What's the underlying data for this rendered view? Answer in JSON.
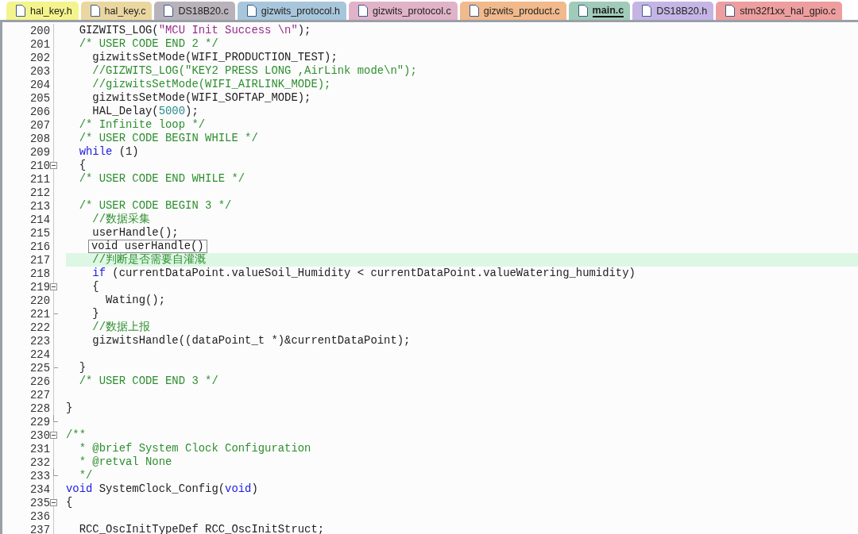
{
  "tabs": [
    {
      "label": "hal_key.h",
      "color": "#f4f48c",
      "selected": false
    },
    {
      "label": "hal_key.c",
      "color": "#ead7a0",
      "selected": false
    },
    {
      "label": "DS18B20.c",
      "color": "#b8b3ba",
      "selected": false
    },
    {
      "label": "gizwits_protocol.h",
      "color": "#a8c6db",
      "selected": false
    },
    {
      "label": "gizwits_protocol.c",
      "color": "#e0b3c8",
      "selected": false
    },
    {
      "label": "gizwits_product.c",
      "color": "#f1b98c",
      "selected": false
    },
    {
      "label": "main.c",
      "color": "#a0cbb8",
      "selected": true
    },
    {
      "label": "DS18B20.h",
      "color": "#c5b5e5",
      "selected": false
    },
    {
      "label": "stm32f1xx_hal_gpio.c",
      "color": "#ee9e9e",
      "selected": false
    }
  ],
  "lines": [
    {
      "number": "200",
      "tokens": [
        {
          "kind": "plain",
          "text": "  GIZWITS_LOG("
        },
        {
          "kind": "string",
          "text": "\"MCU Init Success \\n\""
        },
        {
          "kind": "plain",
          "text": ");"
        }
      ]
    },
    {
      "number": "201",
      "tokens": [
        {
          "kind": "comment",
          "text": "  /* USER CODE END 2 */"
        }
      ]
    },
    {
      "number": "202",
      "tokens": [
        {
          "kind": "plain",
          "text": "    gizwitsSetMode(WIFI_PRODUCTION_TEST);"
        }
      ]
    },
    {
      "number": "203",
      "tokens": [
        {
          "kind": "comment",
          "text": "    //GIZWITS_LOG(\"KEY2 PRESS LONG ,AirLink mode\\n\");"
        }
      ]
    },
    {
      "number": "204",
      "tokens": [
        {
          "kind": "comment",
          "text": "    //gizwitsSetMode(WIFI_AIRLINK_MODE);"
        }
      ]
    },
    {
      "number": "205",
      "tokens": [
        {
          "kind": "plain",
          "text": "    gizwitsSetMode(WIFI_SOFTAP_MODE);"
        }
      ]
    },
    {
      "number": "206",
      "tokens": [
        {
          "kind": "plain",
          "text": "    HAL_Delay("
        },
        {
          "kind": "number",
          "text": "5000"
        },
        {
          "kind": "plain",
          "text": ");"
        }
      ]
    },
    {
      "number": "207",
      "tokens": [
        {
          "kind": "comment",
          "text": "  /* Infinite loop */"
        }
      ]
    },
    {
      "number": "208",
      "tokens": [
        {
          "kind": "comment",
          "text": "  /* USER CODE BEGIN WHILE */"
        }
      ]
    },
    {
      "number": "209",
      "tokens": [
        {
          "kind": "keyword",
          "text": "  while"
        },
        {
          "kind": "plain",
          "text": " (1)"
        }
      ]
    },
    {
      "number": "210",
      "collapsible": true,
      "tokens": [
        {
          "kind": "plain",
          "text": "  {"
        }
      ]
    },
    {
      "number": "211",
      "tokens": [
        {
          "kind": "comment",
          "text": "  /* USER CODE END WHILE */"
        }
      ]
    },
    {
      "number": "212"
    },
    {
      "number": "213",
      "tokens": [
        {
          "kind": "comment",
          "text": "  /* USER CODE BEGIN 3 */"
        }
      ]
    },
    {
      "number": "214",
      "tokens": [
        {
          "kind": "comment",
          "text": "    //数据采集"
        }
      ]
    },
    {
      "number": "215",
      "tokens": [
        {
          "kind": "plain",
          "text": "    userHandle();"
        }
      ]
    },
    {
      "number": "216",
      "tooltip": "void userHandle()"
    },
    {
      "number": "217",
      "current": true,
      "tokens": [
        {
          "kind": "comment",
          "text": "    //判断是否需要自灌溉"
        }
      ]
    },
    {
      "number": "218",
      "tokens": [
        {
          "kind": "keyword",
          "text": "    if"
        },
        {
          "kind": "plain",
          "text": " (currentDataPoint.valueSoil_Humidity < currentDataPoint.valueWatering_humidity)"
        }
      ]
    },
    {
      "number": "219",
      "collapsible": true,
      "tokens": [
        {
          "kind": "plain",
          "text": "    {"
        }
      ]
    },
    {
      "number": "220",
      "tokens": [
        {
          "kind": "plain",
          "text": "      Wating();"
        }
      ]
    },
    {
      "number": "221",
      "inner_block_end": true,
      "tokens": [
        {
          "kind": "plain",
          "text": "    }"
        }
      ]
    },
    {
      "number": "222",
      "tokens": [
        {
          "kind": "comment",
          "text": "    //数据上报"
        }
      ]
    },
    {
      "number": "223",
      "tokens": [
        {
          "kind": "plain",
          "text": "    gizwitsHandle((dataPoint_t *)&currentDataPoint);"
        }
      ]
    },
    {
      "number": "224"
    },
    {
      "number": "225",
      "inner_block_end": true,
      "tokens": [
        {
          "kind": "plain",
          "text": "  }"
        }
      ]
    },
    {
      "number": "226",
      "tokens": [
        {
          "kind": "comment",
          "text": "  /* USER CODE END 3 */"
        }
      ]
    },
    {
      "number": "227"
    },
    {
      "number": "228",
      "tokens": [
        {
          "kind": "plain",
          "text": "}"
        }
      ]
    },
    {
      "number": "229",
      "block_end": true
    },
    {
      "number": "230",
      "collapsible": true,
      "tokens": [
        {
          "kind": "comment",
          "text": "/**"
        }
      ]
    },
    {
      "number": "231",
      "tokens": [
        {
          "kind": "comment",
          "text": "  * @brief System Clock Configuration"
        }
      ]
    },
    {
      "number": "232",
      "tokens": [
        {
          "kind": "comment",
          "text": "  * @retval None"
        }
      ]
    },
    {
      "number": "233",
      "block_end": true,
      "tokens": [
        {
          "kind": "comment",
          "text": "  */"
        }
      ]
    },
    {
      "number": "234",
      "tokens": [
        {
          "kind": "keyword",
          "text": "void"
        },
        {
          "kind": "plain",
          "text": " SystemClock_Config("
        },
        {
          "kind": "keyword",
          "text": "void"
        },
        {
          "kind": "plain",
          "text": ")"
        }
      ]
    },
    {
      "number": "235",
      "collapsible": true,
      "tokens": [
        {
          "kind": "plain",
          "text": "{"
        }
      ]
    },
    {
      "number": "236"
    },
    {
      "number": "237",
      "tokens": [
        {
          "kind": "plain",
          "text": "  RCC_OscInitTypeDef RCC_OscInitStruct;"
        }
      ]
    }
  ]
}
